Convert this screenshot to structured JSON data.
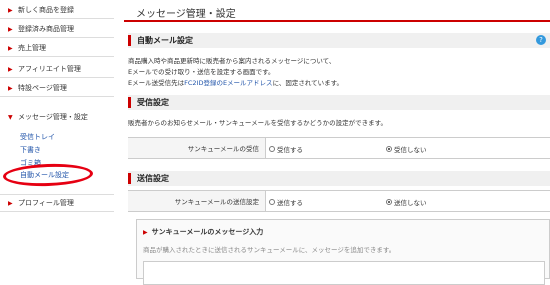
{
  "sidebar": {
    "items": [
      {
        "label": "新しく商品を登録"
      },
      {
        "label": "登録済み商品管理"
      },
      {
        "label": "売上管理"
      },
      {
        "label": "アフィリエイト管理"
      },
      {
        "label": "特設ページ管理"
      },
      {
        "label": "メッセージ管理・設定"
      },
      {
        "label": "プロフィール管理"
      }
    ],
    "subitems": [
      {
        "label": "受信トレイ"
      },
      {
        "label": "下書き"
      },
      {
        "label": "ゴミ箱"
      },
      {
        "label": "自動メール設定"
      }
    ],
    "arrow_closed": "▶",
    "arrow_open": "▼"
  },
  "main": {
    "page_title": "メッセージ管理・設定",
    "auto_mail": {
      "title": "自動メール設定",
      "help": "?",
      "desc1": "商品購入時や商品更新時に販売者から案内されるメッセージについて、",
      "desc2": "Eメールでの受け取り・送信を設定する画面です。",
      "desc3_a": "Eメール送受信先は",
      "desc3_link": "FC2ID登録のEメールアドレス",
      "desc3_b": "に、固定されています。"
    },
    "receive": {
      "title": "受信設定",
      "desc": "販売者からのお知らせメール・サンキューメールを受信するかどうかの設定ができます。",
      "row_label": "サンキューメールの受信",
      "opt_on": "受信する",
      "opt_off": "受信しない",
      "selected": "off"
    },
    "send": {
      "title": "送信設定",
      "row_label": "サンキューメールの送信設定",
      "opt_on": "送信する",
      "opt_off": "送信しない",
      "selected": "off"
    },
    "thanks_box": {
      "title": "サンキューメールのメッセージ入力",
      "marker": "▶",
      "desc": "商品が購入されたときに送信されるサンキューメールに、メッセージを追加できます。"
    }
  },
  "colors": {
    "accent": "#cc0000",
    "link": "#2255aa",
    "highlight_circle": "#e60012"
  }
}
